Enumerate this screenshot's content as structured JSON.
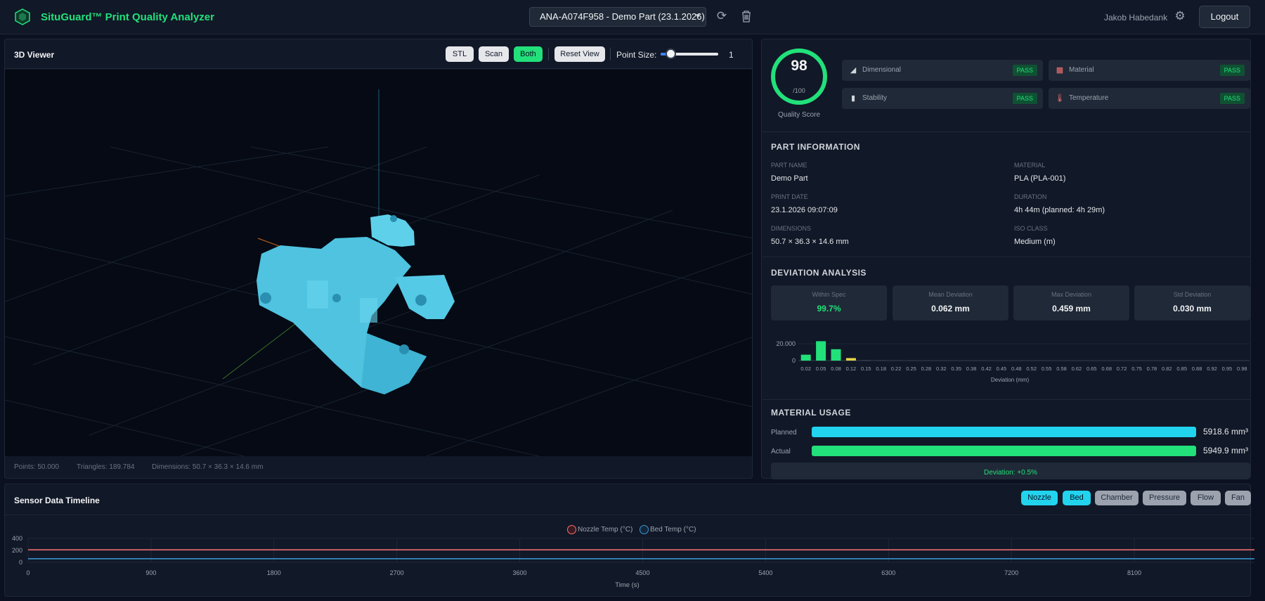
{
  "header": {
    "brand": "SituGuard™ Print Quality Analyzer",
    "analysis_select": "ANA-A074F958 - Demo Part (23.1.2026)",
    "user": "Jakob Habedank",
    "logout_label": "Logout",
    "icons": [
      "refresh-icon",
      "trash-icon",
      "gear-icon"
    ]
  },
  "viewer": {
    "title": "3D Viewer",
    "buttons": {
      "stl": "STL",
      "scan": "Scan",
      "both": "Both",
      "reset": "Reset View"
    },
    "active_mode": "Both",
    "point_size_label": "Point Size:",
    "point_size_value": "1",
    "stats": {
      "points": "Points: 50.000",
      "triangles": "Triangles: 189.784",
      "dimensions": "Dimensions: 50.7 × 36.3 × 14.6 mm"
    }
  },
  "quality": {
    "score": "98",
    "score_max": "/100",
    "score_label": "Quality Score",
    "score_fraction": 0.98,
    "checks": [
      {
        "label": "Dimensional",
        "status": "PASS",
        "icon": "ruler-icon"
      },
      {
        "label": "Material",
        "status": "PASS",
        "icon": "spool-icon"
      },
      {
        "label": "Stability",
        "status": "PASS",
        "icon": "bar-chart-icon"
      },
      {
        "label": "Temperature",
        "status": "PASS",
        "icon": "thermometer-icon"
      }
    ]
  },
  "part_info": {
    "title": "PART INFORMATION",
    "part_name_label": "PART NAME",
    "part_name": "Demo Part",
    "material_label": "MATERIAL",
    "material": "PLA (PLA-001)",
    "print_date_label": "PRINT DATE",
    "print_date": "23.1.2026 09:07:09",
    "duration_label": "DURATION",
    "duration": "4h 44m (planned: 4h 29m)",
    "dimensions_label": "DIMENSIONS",
    "dimensions": "50.7 × 36.3 × 14.6 mm",
    "iso_label": "ISO CLASS",
    "iso_class": "Medium (m)"
  },
  "deviation": {
    "title": "DEVIATION ANALYSIS",
    "stats": [
      {
        "label": "Within Spec",
        "value": "99.7%"
      },
      {
        "label": "Mean Deviation",
        "value": "0.062 mm"
      },
      {
        "label": "Max Deviation",
        "value": "0.459 mm"
      },
      {
        "label": "Std Deviation",
        "value": "0.030 mm"
      }
    ]
  },
  "material_usage": {
    "title": "MATERIAL USAGE",
    "planned_label": "Planned",
    "planned_value": "5918.6 mm³",
    "actual_label": "Actual",
    "actual_value": "5949.9 mm³",
    "deviation_text": "Deviation: +0.5%"
  },
  "sensor": {
    "title": "Sensor Data Timeline",
    "buttons": [
      {
        "label": "Nozzle",
        "active": true
      },
      {
        "label": "Bed",
        "active": true
      },
      {
        "label": "Chamber",
        "active": false
      },
      {
        "label": "Pressure",
        "active": false
      },
      {
        "label": "Flow",
        "active": false
      },
      {
        "label": "Fan",
        "active": false
      }
    ]
  },
  "colors": {
    "accent": "#22e07a",
    "cyan": "#22d3ee",
    "nozzle": "#f87171",
    "bed": "#3b9ad9"
  },
  "chart_data": [
    {
      "type": "bar",
      "xlabel": "Deviation (mm)",
      "ylabel": "",
      "ylim": [
        0,
        20000
      ],
      "yticks": [
        "20.000",
        "0"
      ],
      "categories": [
        "0.02",
        "0.05",
        "0.08",
        "0.12",
        "0.15",
        "0.18",
        "0.22",
        "0.25",
        "0.28",
        "0.32",
        "0.35",
        "0.38",
        "0.42",
        "0.45",
        "0.48",
        "0.52",
        "0.55",
        "0.58",
        "0.62",
        "0.65",
        "0.68",
        "0.72",
        "0.75",
        "0.78",
        "0.82",
        "0.85",
        "0.88",
        "0.92",
        "0.95",
        "0.98"
      ],
      "values": [
        7000,
        23000,
        13500,
        3000,
        300,
        150,
        80,
        50,
        30,
        20,
        10,
        8,
        5,
        3,
        0,
        0,
        0,
        0,
        0,
        0,
        0,
        0,
        0,
        0,
        0,
        0,
        0,
        0,
        0,
        0
      ],
      "grid": true
    },
    {
      "type": "line",
      "xlabel": "Time (s)",
      "ylabel": "",
      "xlim": [
        0,
        8980
      ],
      "ylim": [
        0,
        400
      ],
      "xticks": [
        "0",
        "900",
        "1800",
        "2700",
        "3600",
        "4500",
        "5400",
        "6300",
        "7200",
        "8100"
      ],
      "yticks": [
        "400",
        "200",
        "0"
      ],
      "series": [
        {
          "name": "Nozzle Temp (°C)",
          "x": [
            0,
            8980
          ],
          "values": [
            210,
            210
          ]
        },
        {
          "name": "Bed Temp (°C)",
          "x": [
            0,
            8980
          ],
          "values": [
            60,
            60
          ]
        }
      ],
      "legend": "top-center",
      "grid": true
    }
  ]
}
